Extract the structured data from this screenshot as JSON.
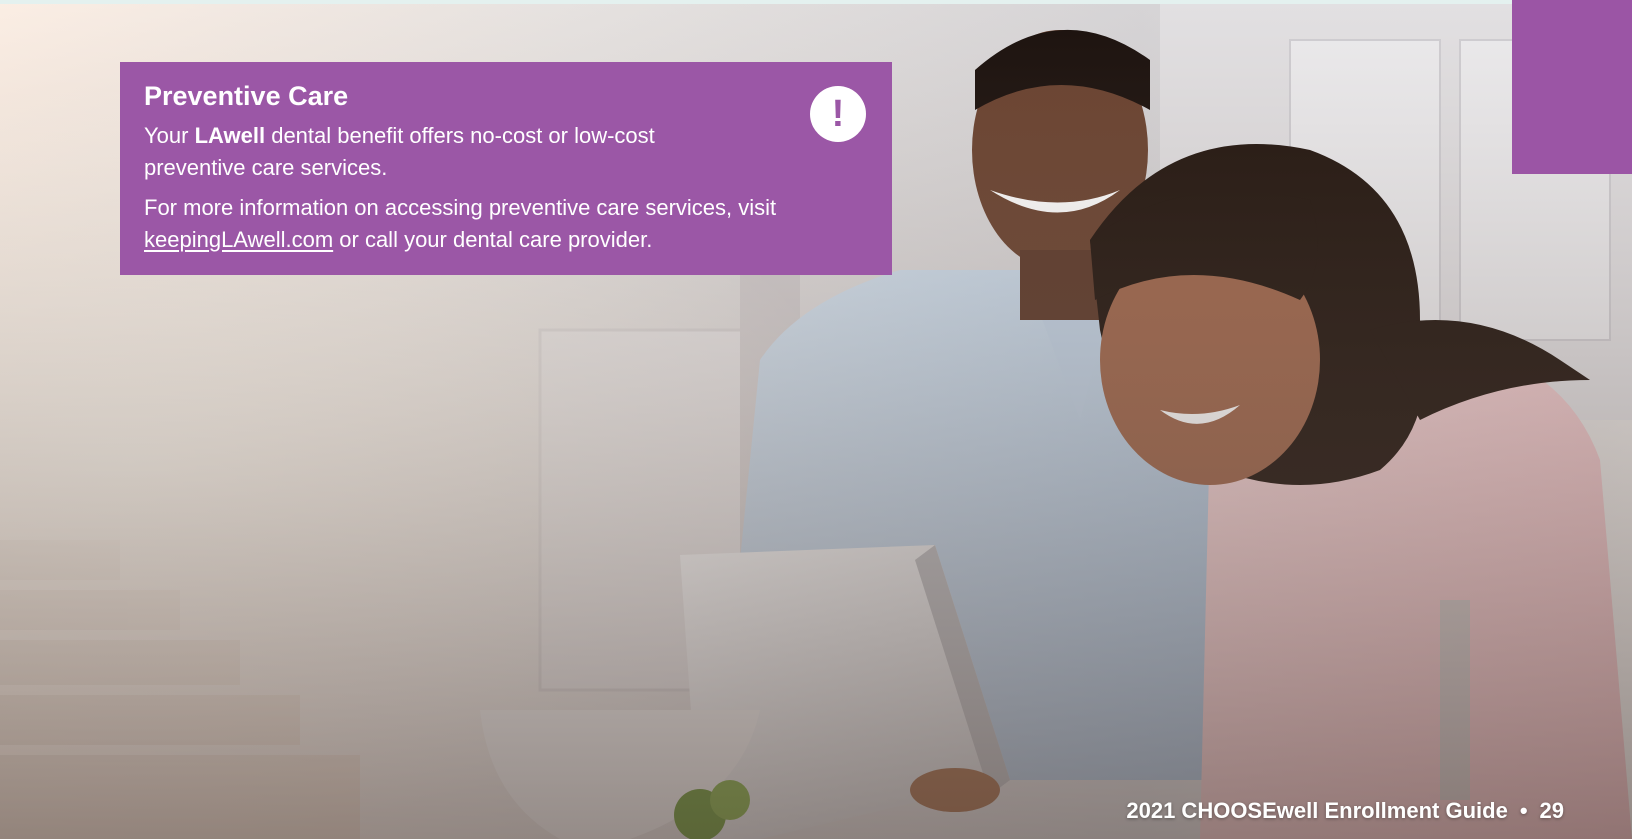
{
  "callout": {
    "title": "Preventive Care",
    "line1_prefix": "Your ",
    "brand": "LAwell",
    "line1_suffix": " dental benefit offers no-cost or low-cost preventive care services.",
    "line2_prefix": "For more information on accessing preventive care services, visit ",
    "link_text": "keepingLAwell.com",
    "line2_suffix": " or call your dental care provider.",
    "icon": "!"
  },
  "footer": {
    "guide_title": "2021 CHOOSEwell Enrollment Guide",
    "separator": "•",
    "page_number": "29"
  },
  "colors": {
    "accent_purple": "#9b57a6",
    "top_strip": "#e4f1ef"
  }
}
